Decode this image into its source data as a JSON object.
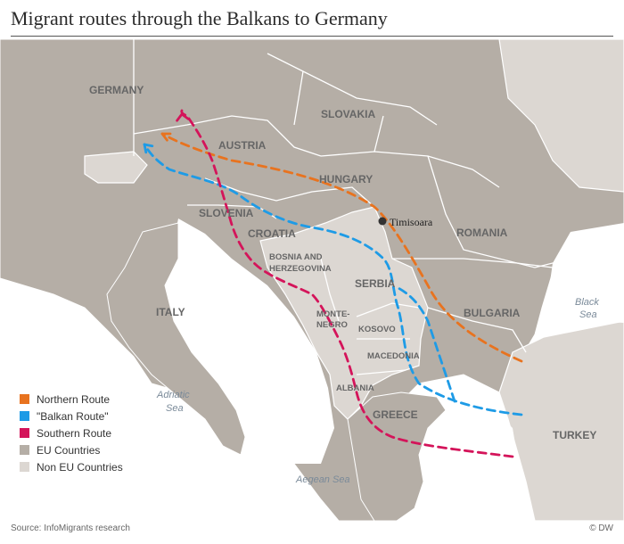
{
  "title": "Migrant routes through the Balkans to Germany",
  "countries": {
    "germany": "GERMANY",
    "slovakia": "SLOVAKIA",
    "austria": "AUSTRIA",
    "hungary": "HUNGARY",
    "slovenia": "SLOVENIA",
    "croatia": "CROATIA",
    "romania": "ROMANIA",
    "bosnia_1": "BOSNIA AND",
    "bosnia_2": "HERZEGOVINA",
    "serbia": "SERBIA",
    "italy": "ITALY",
    "bulgaria": "BULGARIA",
    "montenegro_1": "MONTE-",
    "montenegro_2": "NEGRO",
    "kosovo": "KOSOVO",
    "macedonia": "MACEDONIA",
    "albania": "ALBANIA",
    "greece": "GREECE",
    "turkey": "TURKEY"
  },
  "seas": {
    "black_1": "Black",
    "black_2": "Sea",
    "adriatic_1": "Adriatic",
    "adriatic_2": "Sea",
    "aegean": "Aegean Sea"
  },
  "city": "Timisoara",
  "legend": [
    {
      "label": "Northern Route",
      "color": "#e8731f"
    },
    {
      "label": "\"Balkan Route\"",
      "color": "#1e9be6"
    },
    {
      "label": "Southern Route",
      "color": "#d4145a"
    },
    {
      "label": "EU Countries",
      "color": "#b5aea6"
    },
    {
      "label": "Non EU Countries",
      "color": "#dcd7d2"
    }
  ],
  "colors": {
    "sea": "#ffffff",
    "eu": "#b5aea6",
    "non_eu": "#dcd7d2",
    "border": "#ffffff",
    "northern_route": "#e8731f",
    "balkan_route": "#1e9be6",
    "southern_route": "#d4145a"
  },
  "source": "Source: InfoMigrants research",
  "credit": "© DW"
}
